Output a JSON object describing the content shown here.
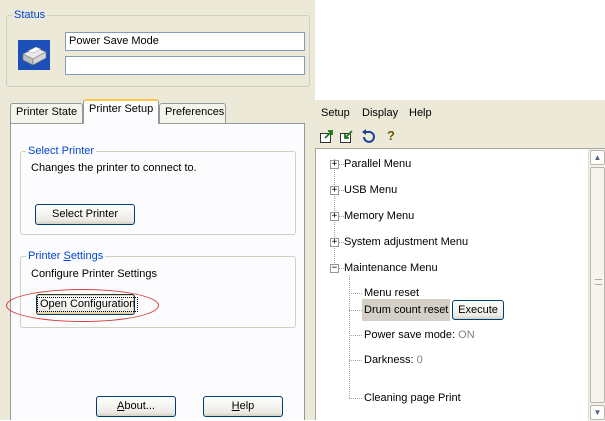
{
  "status": {
    "legend": "Status",
    "mode_text": "Power Save Mode",
    "secondary_text": ""
  },
  "tabs": [
    {
      "label": "Printer State"
    },
    {
      "label": "Printer Setup"
    },
    {
      "label": "Preferences"
    }
  ],
  "select_printer": {
    "legend": "Select Printer",
    "description": "Changes the printer to connect to.",
    "button_label": "Select Printer"
  },
  "printer_settings": {
    "legend_prefix": "Printer ",
    "legend_accel": "S",
    "legend_suffix": "ettings",
    "description": "Configure Printer Settings",
    "button_label": "Open Configuration"
  },
  "footer": {
    "about_accel": "A",
    "about_rest": "bout...",
    "help_accel": "H",
    "help_rest": "elp"
  },
  "menubar": [
    "Setup",
    "Display",
    "Help"
  ],
  "toolbar": {
    "icons": [
      "export-icon",
      "import-icon",
      "undo-icon",
      "help-icon"
    ]
  },
  "tree": {
    "collapsed": [
      {
        "label": "Parallel Menu"
      },
      {
        "label": "USB Menu"
      },
      {
        "label": "Memory Menu"
      },
      {
        "label": "System adjustment Menu"
      }
    ],
    "expanded": {
      "label": "Maintenance Menu"
    },
    "children": {
      "menu_reset": "Menu reset",
      "drum_count_reset": "Drum count reset",
      "execute_label": "Execute",
      "power_save_label": "Power save mode:",
      "power_save_value": "ON",
      "darkness_label": "Darkness:",
      "darkness_value": "0",
      "cleaning_page": "Cleaning page Print"
    }
  },
  "colors": {
    "accent_blue": "#0046d5",
    "highlight_ring": "#d43a3a",
    "window_bg": "#ece9d8"
  }
}
